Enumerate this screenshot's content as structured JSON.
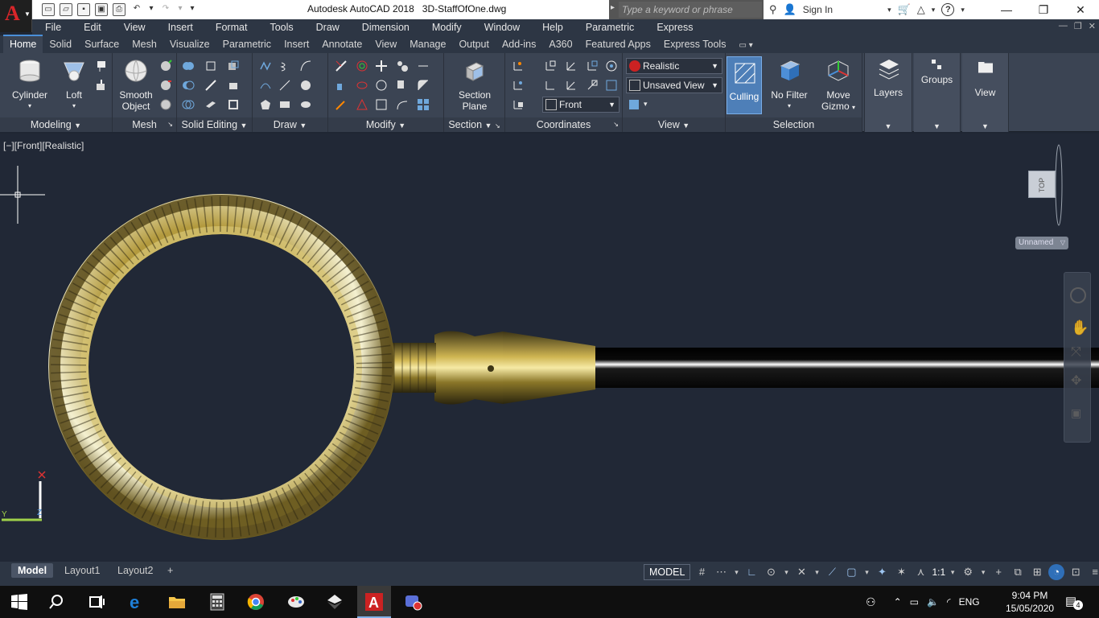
{
  "window": {
    "app_name": "Autodesk AutoCAD 2018",
    "file_name": "3D-StaffOfOne.dwg",
    "search_placeholder": "Type a keyword or phrase",
    "sign_in": "Sign In"
  },
  "menu": [
    "File",
    "Edit",
    "View",
    "Insert",
    "Format",
    "Tools",
    "Draw",
    "Dimension",
    "Modify",
    "Window",
    "Help",
    "Parametric",
    "Express"
  ],
  "ribbon_tabs": [
    "Home",
    "Solid",
    "Surface",
    "Mesh",
    "Visualize",
    "Parametric",
    "Insert",
    "Annotate",
    "View",
    "Manage",
    "Output",
    "Add-ins",
    "A360",
    "Featured Apps",
    "Express Tools"
  ],
  "active_tab": "Home",
  "panels": {
    "modeling": "Modeling",
    "mesh": "Mesh",
    "solid_editing": "Solid Editing",
    "draw": "Draw",
    "modify": "Modify",
    "section": "Section",
    "coordinates": "Coordinates",
    "view": "View",
    "selection": "Selection"
  },
  "buttons": {
    "cylinder": "Cylinder",
    "loft": "Loft",
    "smooth_object_1": "Smooth",
    "smooth_object_2": "Object",
    "section_plane_1": "Section",
    "section_plane_2": "Plane",
    "culling": "Culling",
    "no_filter": "No Filter",
    "move_gizmo_1": "Move",
    "move_gizmo_2": "Gizmo",
    "layers": "Layers",
    "groups": "Groups",
    "view": "View"
  },
  "combos": {
    "visual_style": "Realistic",
    "named_view": "Unsaved View",
    "ucs": "Front"
  },
  "viewport": {
    "label": "[−][Front][Realistic]",
    "viewcube_face": "TOP",
    "wcs": "Unnamed"
  },
  "layout_tabs": [
    "Model",
    "Layout1",
    "Layout2"
  ],
  "active_layout": "Model",
  "status": {
    "space": "MODEL",
    "scale": "1:1"
  },
  "taskbar": {
    "language": "ENG",
    "time": "9:04 PM",
    "date": "15/05/2020",
    "notifications": "4"
  }
}
